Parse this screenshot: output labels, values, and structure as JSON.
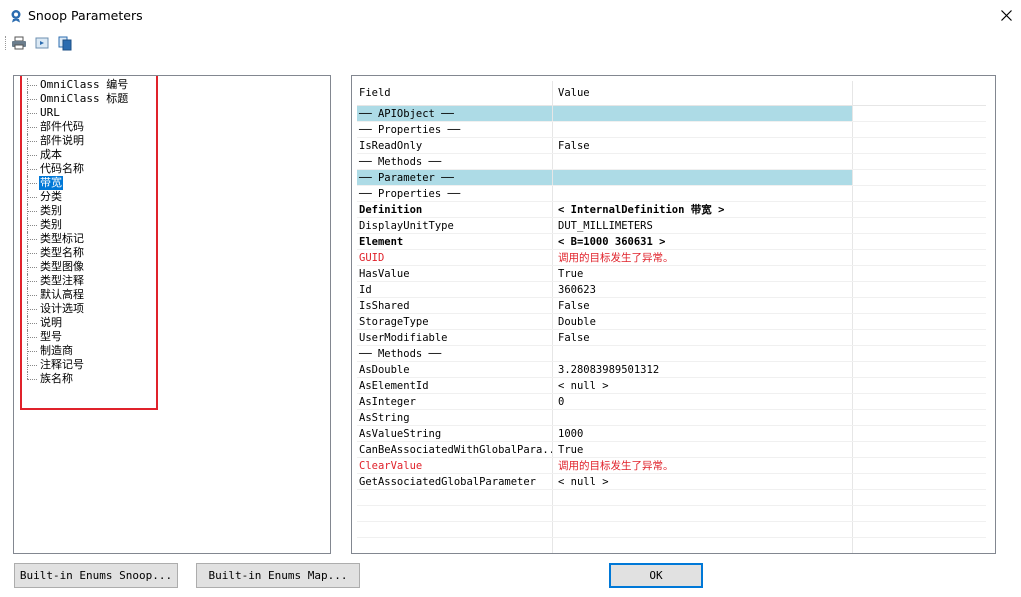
{
  "window": {
    "title": "Snoop Parameters"
  },
  "toolbar": {
    "buttons": [
      {
        "name": "print-icon"
      },
      {
        "name": "print-preview-icon"
      },
      {
        "name": "copy-icon"
      }
    ]
  },
  "tree": {
    "items": [
      "OmniClass 编号",
      "OmniClass 标题",
      "URL",
      "部件代码",
      "部件说明",
      "成本",
      "代码名称",
      "带宽",
      "分类",
      "类别",
      "类别",
      "类型标记",
      "类型名称",
      "类型图像",
      "类型注释",
      "默认高程",
      "设计选项",
      "说明",
      "型号",
      "制造商",
      "注释记号",
      "族名称"
    ],
    "selected_index": 7
  },
  "grid": {
    "headers": {
      "field": "Field",
      "value": "Value"
    },
    "rows": [
      {
        "field": "── APIObject ──",
        "value": "",
        "style": "section"
      },
      {
        "field": "   ── Properties ──",
        "value": "",
        "style": ""
      },
      {
        "field": "IsReadOnly",
        "value": "False",
        "style": ""
      },
      {
        "field": "   ── Methods ──",
        "value": "",
        "style": ""
      },
      {
        "field": "── Parameter ──",
        "value": "",
        "style": "section"
      },
      {
        "field": "   ── Properties ──",
        "value": "",
        "style": ""
      },
      {
        "field": "Definition",
        "value": "< InternalDefinition  带宽 >",
        "style": "bold"
      },
      {
        "field": "DisplayUnitType",
        "value": "DUT_MILLIMETERS",
        "style": ""
      },
      {
        "field": "Element",
        "value": "< B=1000  360631 >",
        "style": "bold"
      },
      {
        "field": "GUID",
        "value": "调用的目标发生了异常。",
        "style": "red"
      },
      {
        "field": "HasValue",
        "value": "True",
        "style": ""
      },
      {
        "field": "Id",
        "value": "360623",
        "style": ""
      },
      {
        "field": "IsShared",
        "value": "False",
        "style": ""
      },
      {
        "field": "StorageType",
        "value": "Double",
        "style": ""
      },
      {
        "field": "UserModifiable",
        "value": "False",
        "style": ""
      },
      {
        "field": "   ── Methods ──",
        "value": "",
        "style": ""
      },
      {
        "field": "AsDouble",
        "value": "3.28083989501312",
        "style": ""
      },
      {
        "field": "AsElementId",
        "value": "< null >",
        "style": ""
      },
      {
        "field": "AsInteger",
        "value": "0",
        "style": ""
      },
      {
        "field": "AsString",
        "value": "",
        "style": ""
      },
      {
        "field": "AsValueString",
        "value": "1000",
        "style": ""
      },
      {
        "field": "CanBeAssociatedWithGlobalPara...",
        "value": "True",
        "style": ""
      },
      {
        "field": "ClearValue",
        "value": "调用的目标发生了异常。",
        "style": "red"
      },
      {
        "field": "GetAssociatedGlobalParameter",
        "value": "< null >",
        "style": ""
      },
      {
        "field": "",
        "value": "",
        "style": ""
      },
      {
        "field": "",
        "value": "",
        "style": ""
      },
      {
        "field": "",
        "value": "",
        "style": ""
      },
      {
        "field": "",
        "value": "",
        "style": ""
      }
    ]
  },
  "buttons": {
    "enums_snoop": "Built-in Enums Snoop...",
    "enums_map": "Built-in Enums Map...",
    "ok": "OK"
  },
  "colors": {
    "section_row": "#addbe6",
    "selection": "#0078d7",
    "error_text": "#e0222b",
    "highlight_box": "#e0222b"
  }
}
